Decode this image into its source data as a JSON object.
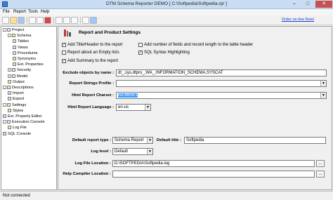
{
  "window": {
    "title": "DTM Schema Reporter DEMO  [ C:\\Softpedia\\Softpedia.rpr ]"
  },
  "menu": [
    "File",
    "Report",
    "Tools",
    "Help"
  ],
  "toolbar": {
    "order_link": "Order on-line Now!"
  },
  "tree": [
    {
      "label": "Project",
      "level": 0,
      "expander": "-"
    },
    {
      "label": "Schema",
      "level": 1,
      "expander": "-"
    },
    {
      "label": "Tables",
      "level": 2
    },
    {
      "label": "Views",
      "level": 2
    },
    {
      "label": "Procedures",
      "level": 2
    },
    {
      "label": "Synonyms",
      "level": 2
    },
    {
      "label": "Ext. Properties",
      "level": 2
    },
    {
      "label": "Security",
      "level": 1,
      "expander": "+"
    },
    {
      "label": "Model",
      "level": 1,
      "expander": "+"
    },
    {
      "label": "Output",
      "level": 1
    },
    {
      "label": "Descriptions",
      "level": 0,
      "expander": "-"
    },
    {
      "label": "Import",
      "level": 1
    },
    {
      "label": "Export",
      "level": 1
    },
    {
      "label": "Settings",
      "level": 0,
      "expander": "-"
    },
    {
      "label": "Styles",
      "level": 1
    },
    {
      "label": "Ext. Property Editor",
      "level": 0
    },
    {
      "label": "Execution Console",
      "level": 0,
      "expander": "-"
    },
    {
      "label": "Log File",
      "level": 1
    },
    {
      "label": "SQL Console",
      "level": 0
    }
  ],
  "panel": {
    "header": "Report and Product Settings",
    "checkboxes": [
      {
        "label": "Add Title/Header to the report",
        "checked": true
      },
      {
        "label": "Report about an Empty lists",
        "checked": false
      },
      {
        "label": "Add Summary to the report",
        "checked": true
      },
      {
        "label": "Add number of fields and record length to the table  header",
        "checked": false
      },
      {
        "label": "SQL Syntax Highlighting",
        "checked": true
      }
    ],
    "exclude_label": "Exclude objects by name :",
    "exclude_value": "dt_,sys,dtpro_,WA_,INFORMATION_SCHEMA,SYSCAT",
    "strings_profile_label": "Report Strings Profile :",
    "strings_profile_value": "",
    "charset_label": "Html Report Charset :",
    "charset_value": "iso-8859-1",
    "language_label": "Html Report Language :",
    "language_value": "en-us",
    "default_type_label": "Default report type :",
    "default_type_value": "Schema Report",
    "default_title_label": "Default title :",
    "default_title_value": "Softpedia",
    "log_level_label": "Log level :",
    "log_level_value": "Default",
    "log_file_label": "Log File Location :",
    "log_file_value": "D:\\SOFTPEDIA\\Softpedia.log",
    "help_label": "Help Compiler Location :",
    "help_value": "",
    "ellipsis": "..."
  },
  "status": "Not connected",
  "titlebar_buttons": {
    "min": "–",
    "max": "□",
    "close": "✕"
  }
}
